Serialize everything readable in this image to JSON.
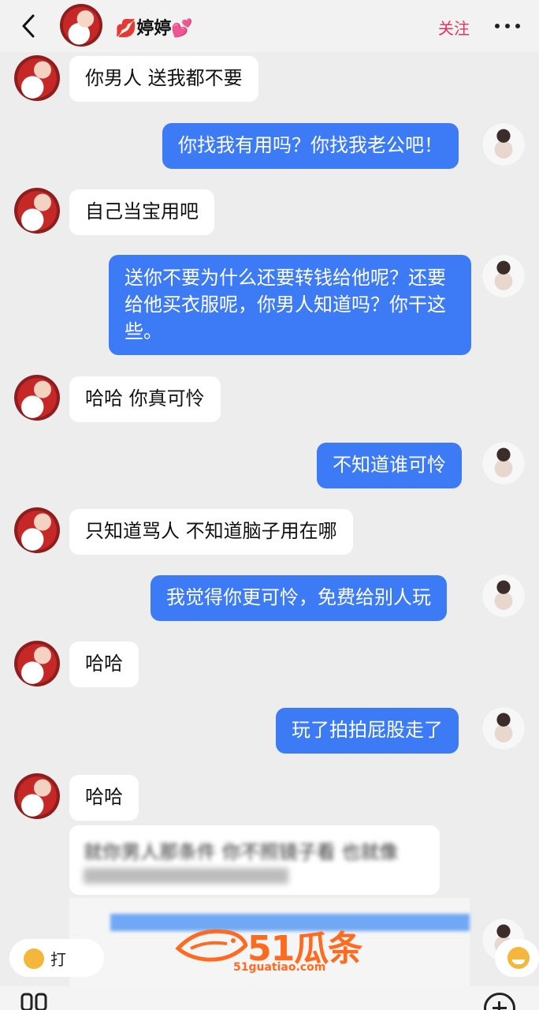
{
  "header": {
    "contact_name": "💋婷婷💕",
    "follow_label": "关注",
    "back_icon": "chevron-left-icon",
    "more_icon": "more-dots-icon"
  },
  "messages": [
    {
      "sender": "contact",
      "text": "你男人 送我都不要"
    },
    {
      "sender": "me",
      "text": "你找我有用吗？你找我老公吧！"
    },
    {
      "sender": "contact",
      "text": "自己当宝用吧"
    },
    {
      "sender": "me",
      "text": "送你不要为什么还要转钱给他呢？还要给他买衣服呢，你男人知道吗？你干这些。"
    },
    {
      "sender": "contact",
      "text": "哈哈 你真可怜"
    },
    {
      "sender": "me",
      "text": "不知道谁可怜"
    },
    {
      "sender": "contact",
      "text": "只知道骂人 不知道脑子用在哪"
    },
    {
      "sender": "me",
      "text": "我觉得你更可怜，免费给别人玩"
    },
    {
      "sender": "contact",
      "text": "哈哈"
    },
    {
      "sender": "me",
      "text": "玩了拍拍屁股走了"
    },
    {
      "sender": "contact",
      "text": "哈哈"
    },
    {
      "sender": "contact",
      "text": "就你男人那条件 你不照镜子看 也就像"
    }
  ],
  "quick_reply": {
    "left_label": "打"
  },
  "watermark": {
    "main": "51瓜条",
    "sub": "51guatiao.com"
  },
  "colors": {
    "outgoing_bubble": "#3d7bf6",
    "incoming_bubble": "#ffffff",
    "follow": "#e5335a",
    "watermark": "#ff6a1f"
  }
}
